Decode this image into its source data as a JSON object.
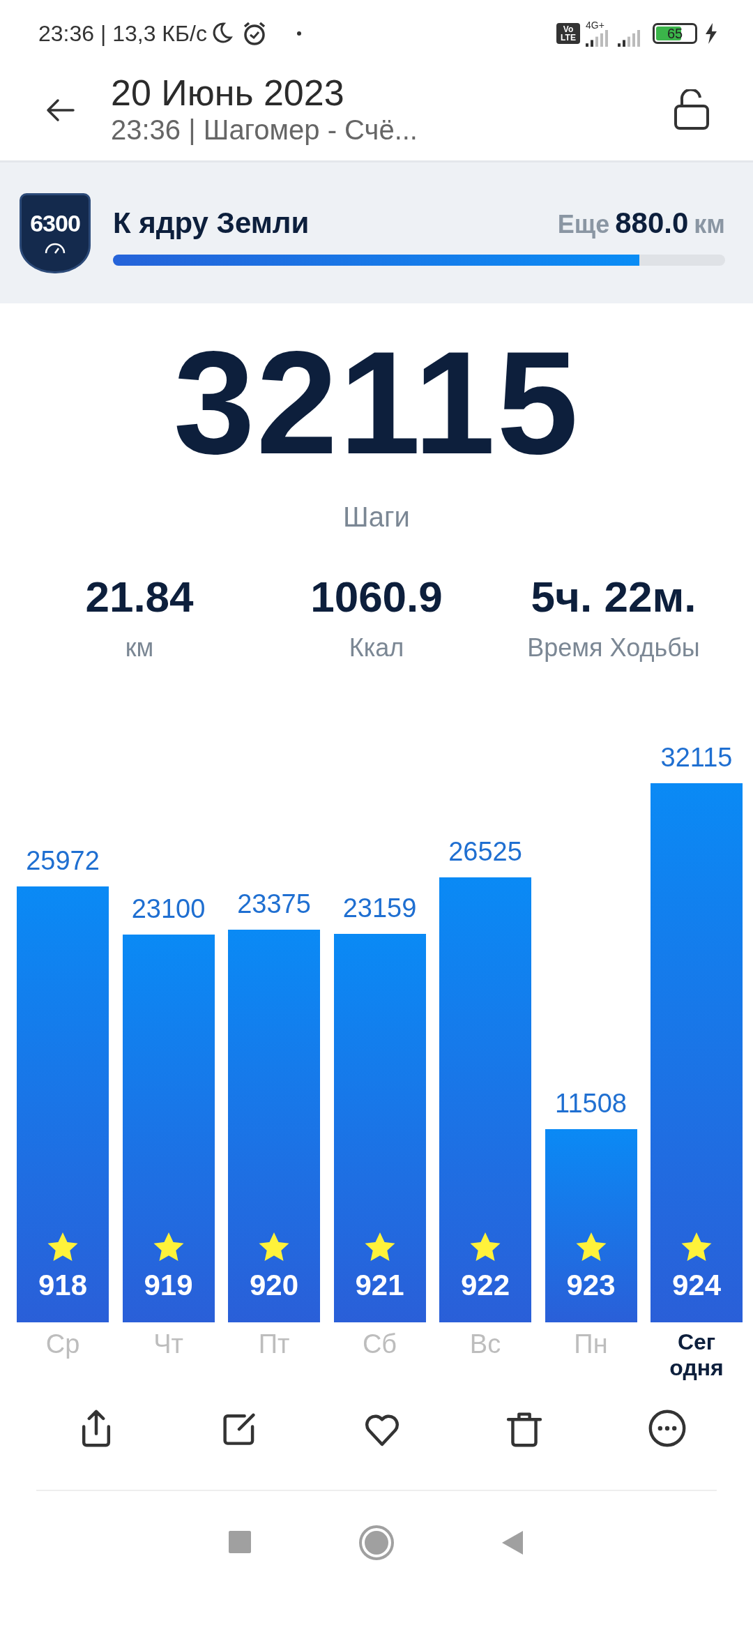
{
  "status_bar": {
    "time": "23:36 | 13,3 КБ/с",
    "volte": [
      "Vo",
      "LTE"
    ],
    "network": "4G+",
    "battery": "65"
  },
  "header": {
    "title": "20 Июнь 2023",
    "subtitle": "23:36 | Шагомер - Счё..."
  },
  "goal": {
    "badge": "6300",
    "title": "К ядру Земли",
    "remaining_label": "Еще",
    "remaining_value": "880.0",
    "remaining_unit": "км",
    "level": 0.86
  },
  "steps": {
    "value": "32115",
    "label": "Шаги"
  },
  "stats": [
    {
      "value": "21.84",
      "label": "км"
    },
    {
      "value": "1060.9",
      "label": "Ккал"
    },
    {
      "value": "5ч. 22м.",
      "label": "Время Ходьбы"
    }
  ],
  "chart_data": {
    "type": "bar",
    "categories": [
      "Ср",
      "Чт",
      "Пт",
      "Сб",
      "Вс",
      "Пн",
      "Сег одня"
    ],
    "values": [
      25972,
      23100,
      23375,
      23159,
      26525,
      11508,
      32115
    ],
    "data_labels": true
  },
  "bars": [
    {
      "badge": "918",
      "selected": false
    },
    {
      "badge": "919",
      "selected": false
    },
    {
      "badge": "920",
      "selected": false
    },
    {
      "badge": "921",
      "selected": false
    },
    {
      "badge": "922",
      "selected": false
    },
    {
      "badge": "923",
      "selected": false
    },
    {
      "badge": "924",
      "selected": true
    }
  ],
  "toolbar": [
    {
      "kind": "share"
    },
    {
      "kind": "edit"
    },
    {
      "kind": "favorite"
    },
    {
      "kind": "delete"
    },
    {
      "kind": "more"
    }
  ],
  "nav_bar": [
    {
      "kind": "recents"
    },
    {
      "kind": "home"
    },
    {
      "kind": "back"
    }
  ]
}
